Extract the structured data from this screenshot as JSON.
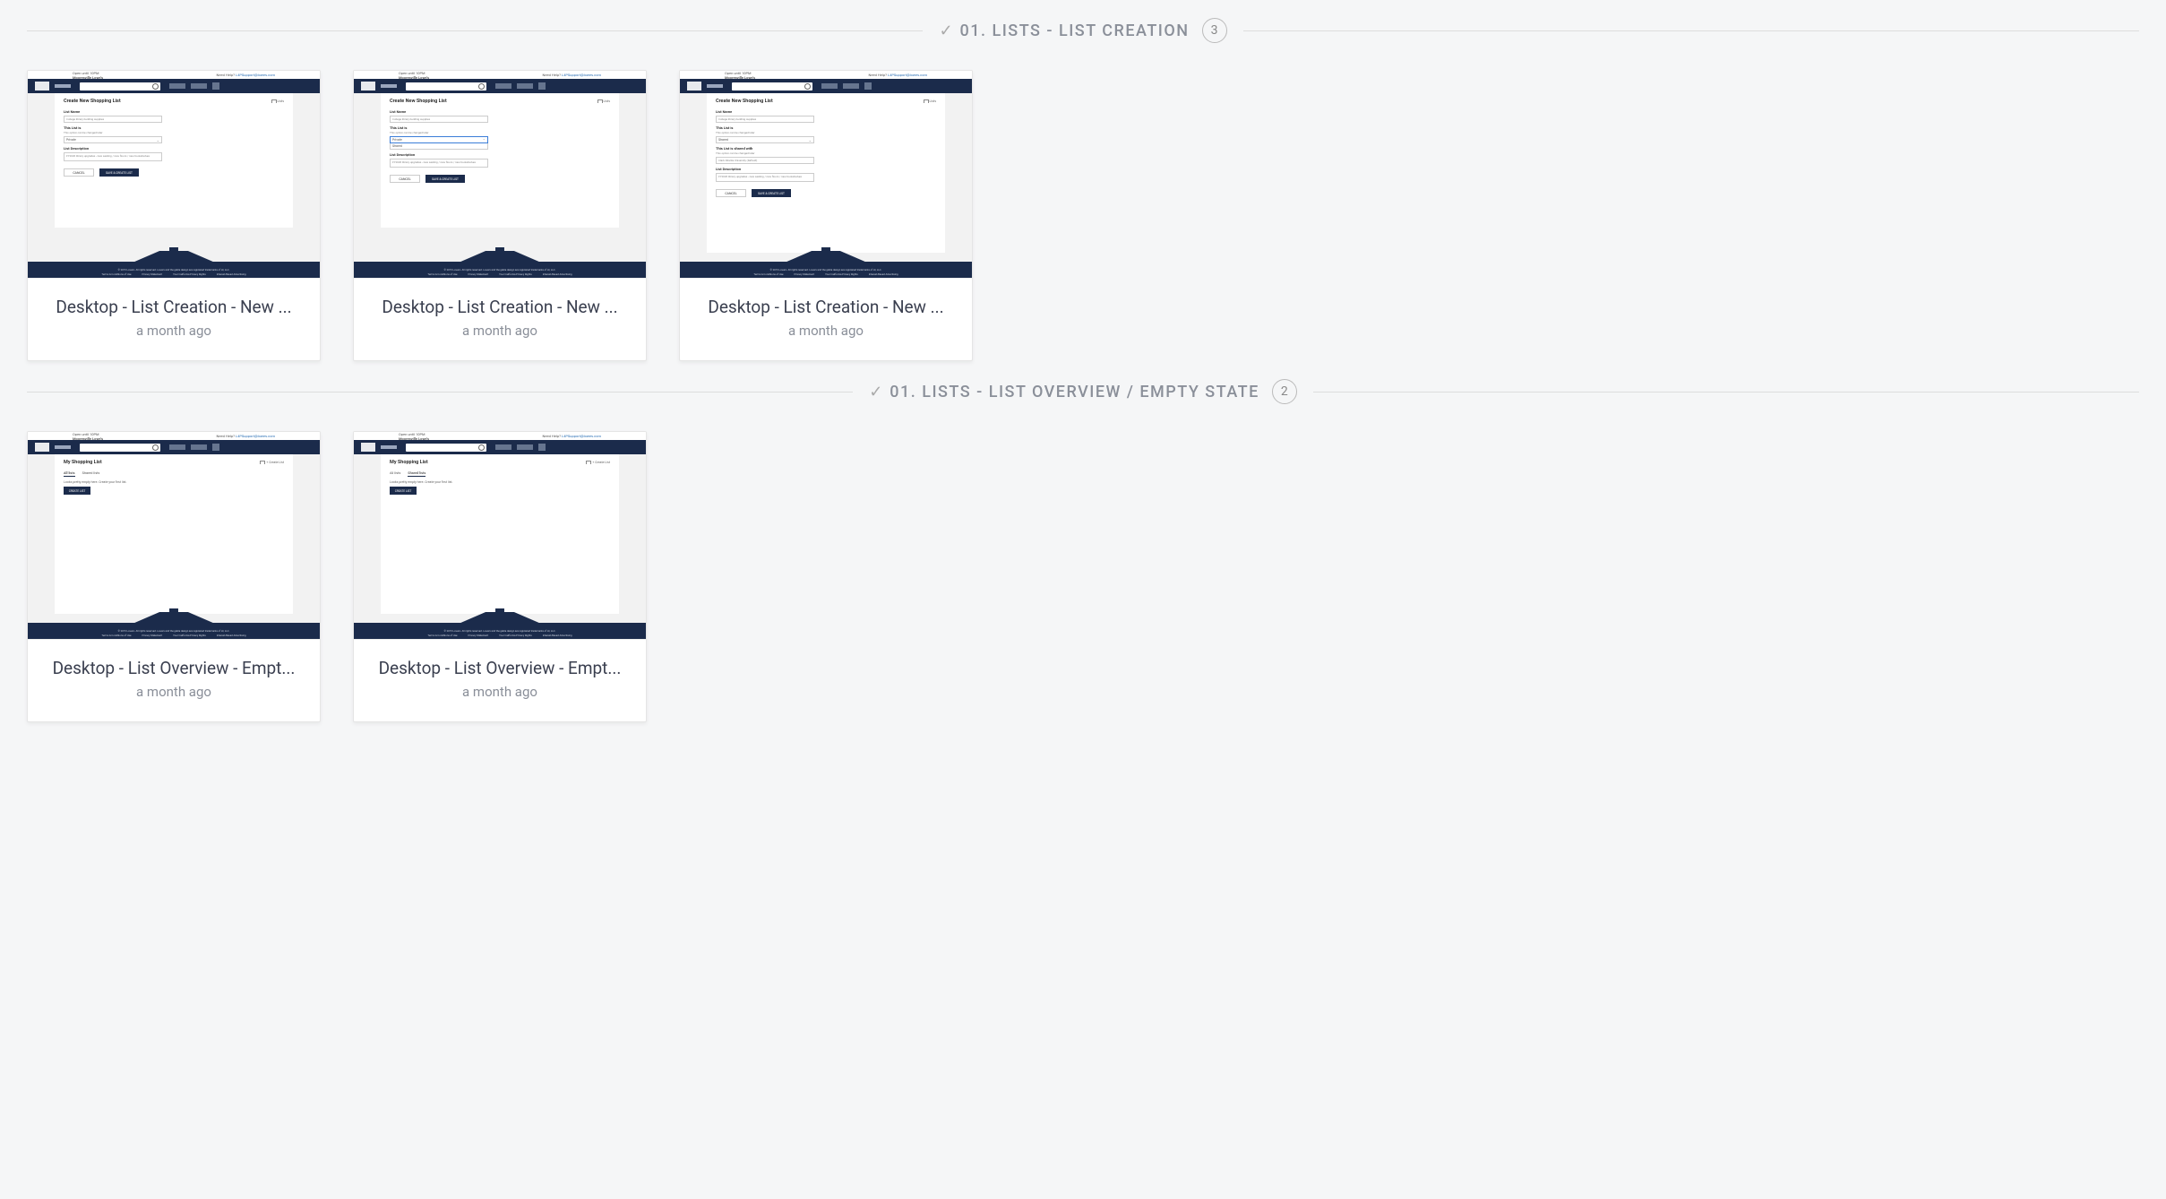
{
  "sections": [
    {
      "checkmark": "✓",
      "title": "01. LISTS - LIST CREATION",
      "count": "3",
      "cards": [
        {
          "title": "Desktop - List Creation - New ...",
          "time": "a month ago",
          "variant": "create_private"
        },
        {
          "title": "Desktop - List Creation - New ...",
          "time": "a month ago",
          "variant": "create_open"
        },
        {
          "title": "Desktop - List Creation - New ...",
          "time": "a month ago",
          "variant": "create_shared"
        }
      ]
    },
    {
      "checkmark": "✓",
      "title": "01. LISTS - LIST OVERVIEW / EMPTY STATE",
      "count": "2",
      "cards": [
        {
          "title": "Desktop - List Overview - Empt...",
          "time": "a month ago",
          "variant": "overview_all"
        },
        {
          "title": "Desktop - List Overview - Empt...",
          "time": "a month ago",
          "variant": "overview_shared"
        }
      ]
    }
  ],
  "mock": {
    "topstrip_left": "Open until 10PM",
    "topstrip_left2": "Mooresville Lowe's",
    "topstrip_right_pre": "Need Help?",
    "topstrip_right_link": "L4PSupport@lowes.com",
    "heading_create": "Create New Shopping List",
    "heading_overview": "My Shopping List",
    "lists_link": "Lists",
    "create_link": "Create List",
    "label_name": "List Name",
    "input_name": "College library building supplies",
    "label_type": "This List is",
    "sublabel_type": "This option can be changed later",
    "select_private": "Private",
    "select_shared": "Shared",
    "label_shared_with": "This List is shared with",
    "input_shared_with": "Clark Atlanta University (Default)",
    "label_desc": "List Description",
    "input_desc": "FY2020 library upgrades - new seating / new floors / new bookshelves",
    "btn_cancel": "CANCEL",
    "btn_save": "SAVE & CREATE LIST",
    "btn_create": "CREATE LIST",
    "tab_all": "All lists",
    "tab_shared": "Shared lists",
    "empty_text": "Looks pretty empty here. Create your first list.",
    "footer_top": "© 2019 Lowe's. All rights reserved. Lowe's and the gable design are registered trademarks of LF, LLC.",
    "footer_l1": "Terms & Conditions of Use",
    "footer_l2": "Privacy Statement",
    "footer_l3": "Your California Privacy Rights",
    "footer_l4": "Interest-Based Advertising"
  }
}
